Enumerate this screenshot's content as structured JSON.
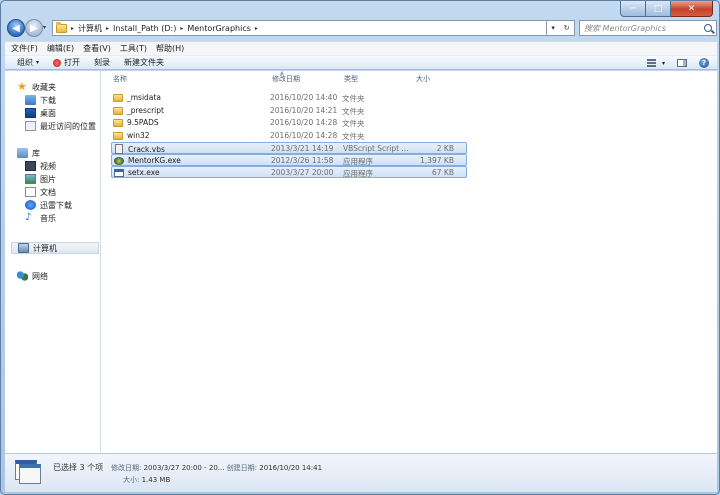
{
  "window": {
    "minimize": "─",
    "maximize": "□",
    "close": "✕"
  },
  "nav": {
    "back": "◀",
    "forward": "▶",
    "history": "▾"
  },
  "address": {
    "sep": "▸",
    "crumbs": [
      "计算机",
      "Install_Path (D:)",
      "MentorGraphics"
    ],
    "dropdown": "▾",
    "refresh": "↻"
  },
  "search": {
    "placeholder": "搜索 MentorGraphics"
  },
  "menu": [
    "文件(F)",
    "编辑(E)",
    "查看(V)",
    "工具(T)",
    "帮助(H)"
  ],
  "toolbar": {
    "organize": "组织",
    "organize_arrow": "▾",
    "open": "打开",
    "burn": "刻录",
    "new_folder": "新建文件夹",
    "view_arrow": "▾",
    "help": "?"
  },
  "sidebar": {
    "favorites": "收藏夹",
    "downloads": "下载",
    "desktop": "桌面",
    "recent": "最近访问的位置",
    "libraries": "库",
    "videos": "视频",
    "pictures": "图片",
    "documents": "文档",
    "thunder": "迅雷下载",
    "music": "音乐",
    "computer": "计算机",
    "network": "网络"
  },
  "columns": {
    "name": "名称",
    "date": "修改日期",
    "type": "类型",
    "size": "大小",
    "sort_indicator": "▲"
  },
  "files": [
    {
      "name": "_msidata",
      "date": "2016/10/20 14:40",
      "type": "文件夹",
      "size": "",
      "kind": "folder",
      "selected": false
    },
    {
      "name": "_prescript",
      "date": "2016/10/20 14:21",
      "type": "文件夹",
      "size": "",
      "kind": "folder",
      "selected": false
    },
    {
      "name": "9.5PADS",
      "date": "2016/10/20 14:28",
      "type": "文件夹",
      "size": "",
      "kind": "folder",
      "selected": false
    },
    {
      "name": "win32",
      "date": "2016/10/20 14:28",
      "type": "文件夹",
      "size": "",
      "kind": "folder",
      "selected": false
    },
    {
      "name": "Crack.vbs",
      "date": "2013/3/21 14:19",
      "type": "VBScript Script ...",
      "size": "2 KB",
      "kind": "vbs",
      "selected": true
    },
    {
      "name": "MentorKG.exe",
      "date": "2012/3/26 11:58",
      "type": "应用程序",
      "size": "1,397 KB",
      "kind": "exe",
      "selected": true
    },
    {
      "name": "setx.exe",
      "date": "2003/3/27 20:00",
      "type": "应用程序",
      "size": "67 KB",
      "kind": "setx",
      "selected": true
    }
  ],
  "status": {
    "selected": "已选择 3 个项",
    "modified_label": "修改日期:",
    "modified_value": "2003/3/27 20:00 - 20...",
    "created_label": "创建日期:",
    "created_value": "2016/10/20 14:41",
    "size_label": "大小:",
    "size_value": "1.43 MB"
  }
}
